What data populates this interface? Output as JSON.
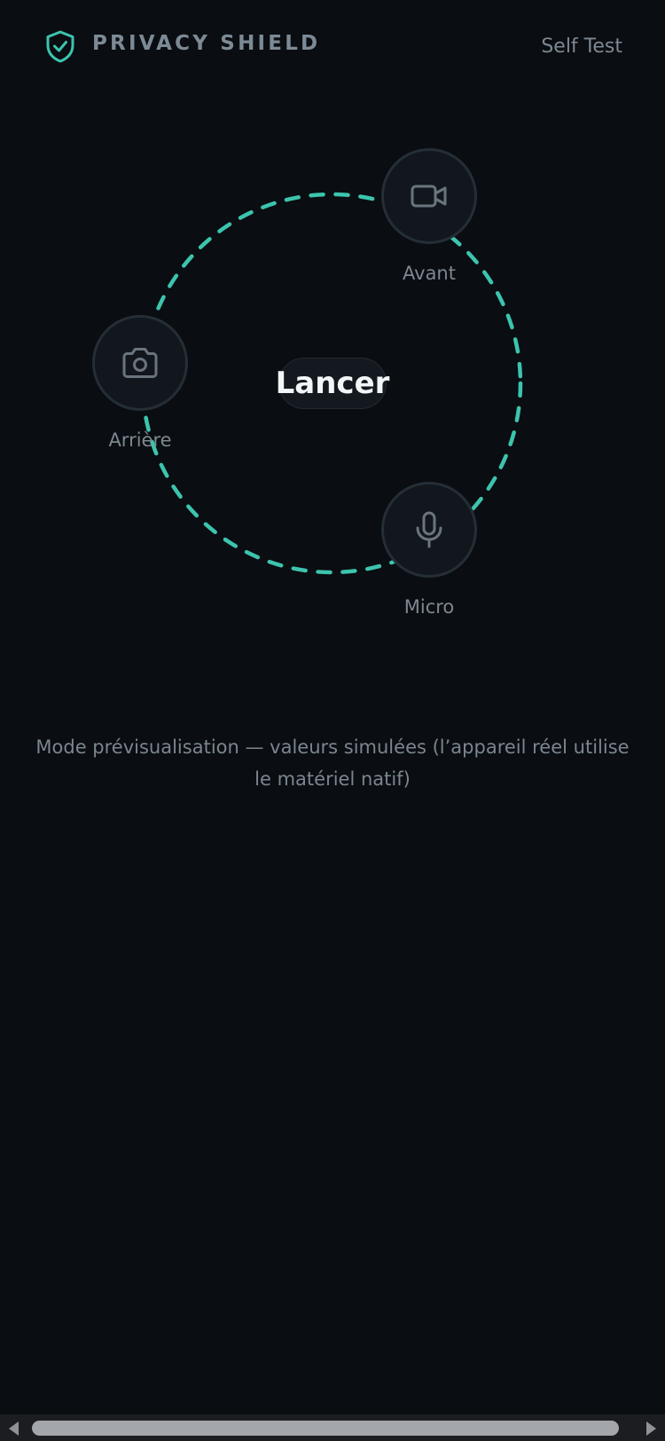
{
  "header": {
    "brand": "PRIVACY SHIELD",
    "self_test": "Self Test",
    "logo_icon": "shield-check-icon"
  },
  "sensors": [
    {
      "label": "Avant",
      "icon": "video-camera-icon"
    },
    {
      "label": "Arrière",
      "icon": "camera-icon"
    },
    {
      "label": "Micro",
      "icon": "microphone-icon"
    }
  ],
  "launch_button": "Lancer",
  "preview_note": "Mode prévisualisation — valeurs simulées (l’appareil réel utilise le matériel natif)",
  "colors": {
    "background": "#0a0d11",
    "accent": "#3cc4ae",
    "node_fill": "#11171d",
    "node_border": "#252e36",
    "muted_text": "#7d8892"
  }
}
